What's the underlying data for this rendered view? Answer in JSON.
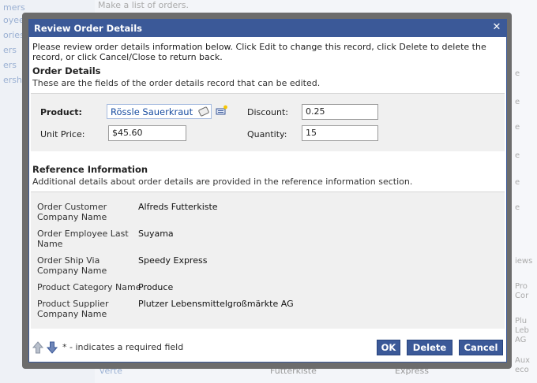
{
  "background": {
    "top_text": "Make a list of orders.",
    "sidebar_items": [
      "mers",
      "oyees",
      "ories",
      "ers",
      "ers",
      "ership"
    ],
    "right_items": [
      "e",
      "e",
      "e",
      "e",
      "e",
      "e",
      "iews",
      "Pro",
      "Cor",
      "Plu",
      "Leb",
      "AG",
      "Aux",
      "eco"
    ],
    "bottom_items": [
      "verte",
      "Futterkiste",
      "Express"
    ]
  },
  "dialog": {
    "title": "Review Order Details",
    "intro": "Please review order details information below. Click Edit to change this record, click Delete to delete the record, or click Cancel/Close to return back.",
    "order_section": {
      "title": "Order Details",
      "description": "These are the fields of the order details record that can be edited."
    },
    "fields": {
      "product_label": "Product:",
      "product_value": "Rössle Sauerkraut",
      "unit_price_label": "Unit Price:",
      "unit_price_value": "$45.60",
      "discount_label": "Discount:",
      "discount_value": "0.25",
      "quantity_label": "Quantity:",
      "quantity_value": "15"
    },
    "reference_section": {
      "title": "Reference Information",
      "description": "Additional details about order details are provided in the reference information section.",
      "rows": [
        {
          "label": "Order Customer Company Name",
          "value": "Alfreds Futterkiste"
        },
        {
          "label": "Order Employee Last Name",
          "value": "Suyama"
        },
        {
          "label": "Order Ship Via Company Name",
          "value": "Speedy Express"
        },
        {
          "label": "Product Category Name",
          "value": "Produce"
        },
        {
          "label": "Product Supplier Company Name",
          "value": "Plutzer Lebensmittelgroßmärkte AG"
        }
      ]
    },
    "footer": {
      "required_note": "* - indicates a required field",
      "ok_label": "OK",
      "delete_label": "Delete",
      "cancel_label": "Cancel"
    },
    "icons": {
      "close": "close-icon",
      "up": "arrow-up-icon",
      "down": "arrow-down-icon",
      "new": "new-item-icon",
      "clear": "eraser-icon"
    },
    "colors": {
      "title_bar": "#3b5998",
      "button": "#3b5998",
      "lookup_text": "#1a4ea1"
    }
  }
}
